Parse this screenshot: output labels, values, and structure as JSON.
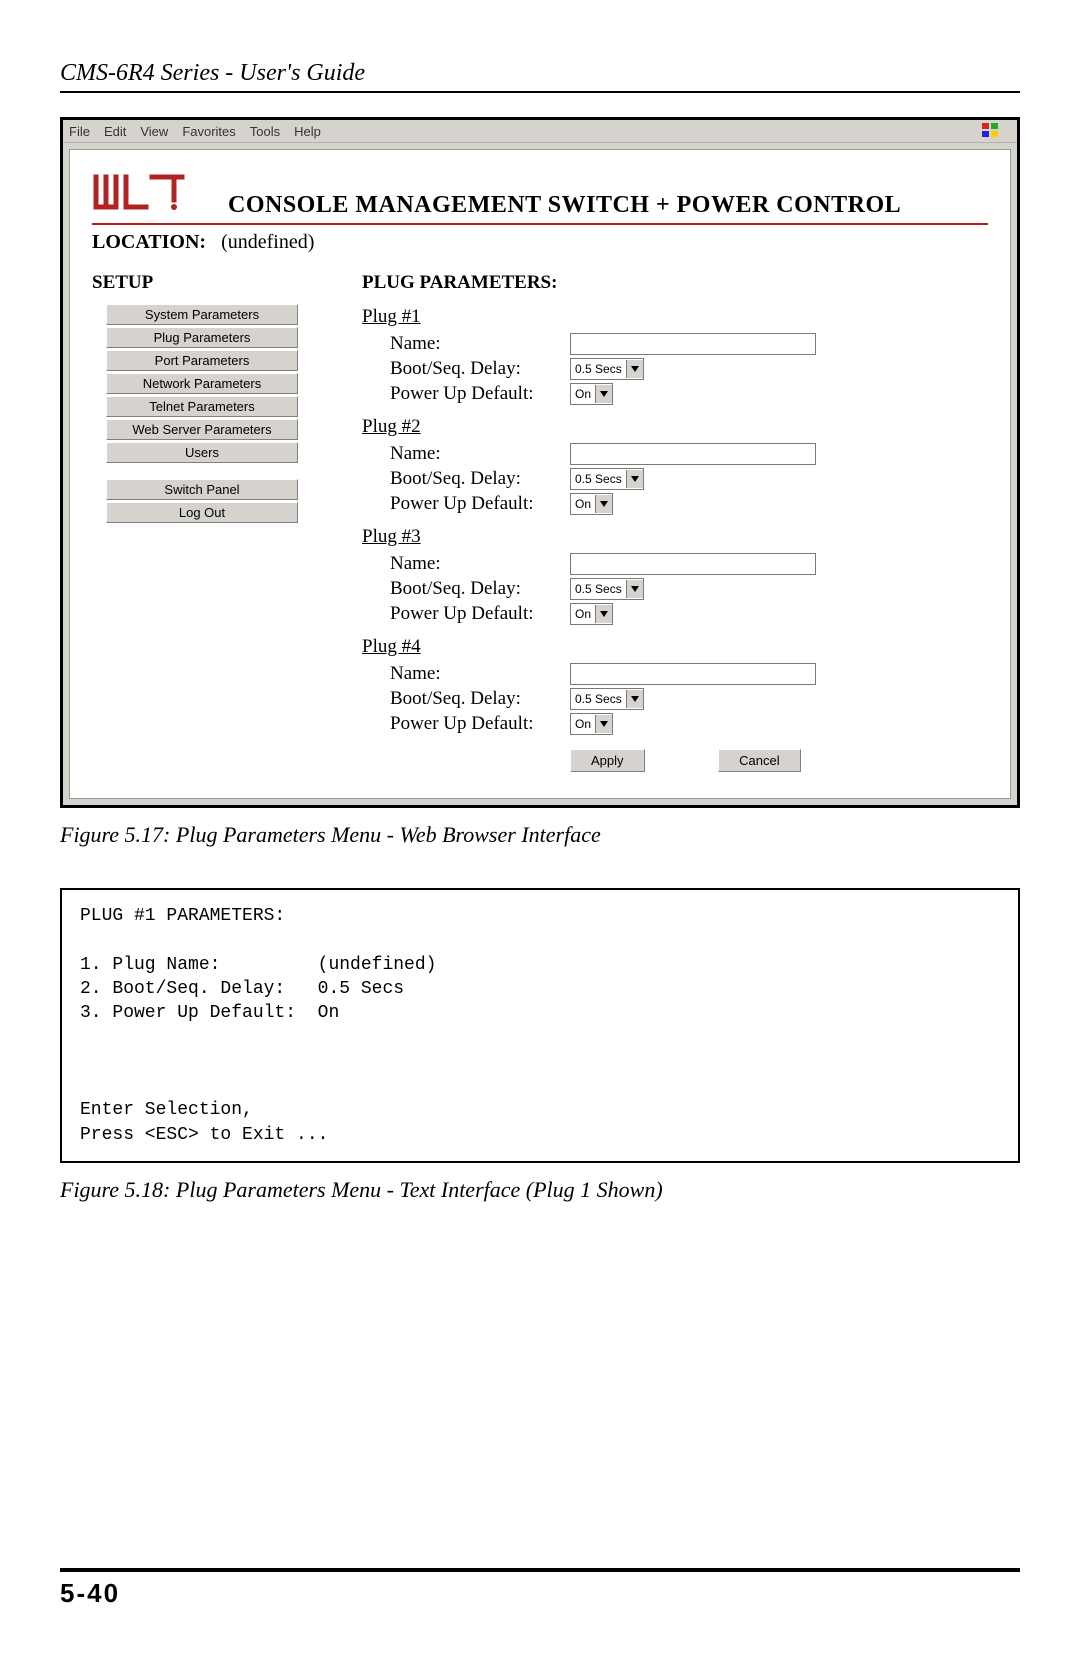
{
  "running_head": "CMS-6R4 Series - User's Guide",
  "ie_menubar": [
    "File",
    "Edit",
    "View",
    "Favorites",
    "Tools",
    "Help"
  ],
  "brand_title": "CONSOLE MANAGEMENT SWITCH + POWER CONTROL",
  "location_label": "LOCATION:",
  "location_value": "(undefined)",
  "sidebar": {
    "title": "SETUP",
    "group1": [
      "System Parameters",
      "Plug Parameters",
      "Port Parameters",
      "Network Parameters",
      "Telnet Parameters",
      "Web Server Parameters",
      "Users"
    ],
    "group2": [
      "Switch Panel",
      "Log Out"
    ]
  },
  "main": {
    "section_title": "PLUG PARAMETERS:",
    "field_labels": {
      "name": "Name:",
      "delay": "Boot/Seq. Delay:",
      "power": "Power Up Default:"
    },
    "plugs": [
      {
        "heading": "Plug #1",
        "name": "",
        "delay": "0.5 Secs",
        "power": "On"
      },
      {
        "heading": "Plug #2",
        "name": "",
        "delay": "0.5 Secs",
        "power": "On"
      },
      {
        "heading": "Plug #3",
        "name": "",
        "delay": "0.5 Secs",
        "power": "On"
      },
      {
        "heading": "Plug #4",
        "name": "",
        "delay": "0.5 Secs",
        "power": "On"
      }
    ],
    "apply": "Apply",
    "cancel": "Cancel"
  },
  "caption1": "Figure 5.17:  Plug Parameters Menu - Web Browser Interface",
  "text_panel": "PLUG #1 PARAMETERS:\n\n1. Plug Name:         (undefined)\n2. Boot/Seq. Delay:   0.5 Secs\n3. Power Up Default:  On\n\n\n\nEnter Selection,\nPress <ESC> to Exit ...",
  "caption2": "Figure 5.18:  Plug Parameters Menu - Text Interface (Plug 1 Shown)",
  "page_number": "5-40"
}
